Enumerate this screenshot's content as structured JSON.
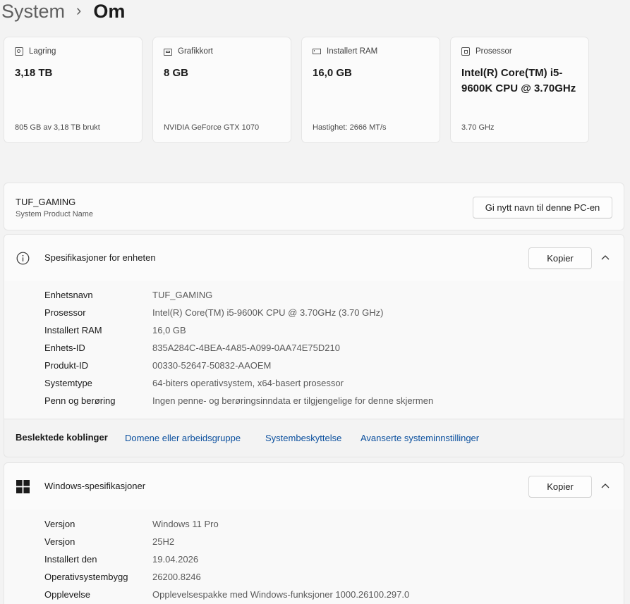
{
  "breadcrumb": {
    "parent": "System",
    "separator": "›",
    "current": "Om"
  },
  "cards": [
    {
      "label": "Lagring",
      "icon": "storage-icon",
      "value": "3,18 TB",
      "sub": "805 GB av 3,18 TB brukt"
    },
    {
      "label": "Grafikkort",
      "icon": "gpu-icon",
      "value": "8 GB",
      "sub": "NVIDIA GeForce GTX 1070"
    },
    {
      "label": "Installert RAM",
      "icon": "ram-icon",
      "value": "16,0 GB",
      "sub": "Hastighet: 2666 MT/s"
    },
    {
      "label": "Prosessor",
      "icon": "cpu-icon",
      "value": "Intel(R) Core(TM) i5-9600K CPU @ 3.70GHz",
      "sub": "3.70 GHz"
    }
  ],
  "pc_name": {
    "name": "TUF_GAMING",
    "subtitle": "System Product Name",
    "rename_label": "Gi nytt navn til denne PC-en"
  },
  "device_specs": {
    "title": "Spesifikasjoner for enheten",
    "copy_label": "Kopier",
    "rows": [
      {
        "key": "Enhetsnavn",
        "value": "TUF_GAMING"
      },
      {
        "key": "Prosessor",
        "value": "Intel(R) Core(TM) i5-9600K CPU @ 3.70GHz (3.70 GHz)"
      },
      {
        "key": "Installert RAM",
        "value": "16,0 GB"
      },
      {
        "key": "Enhets-ID",
        "value": "835A284C-4BEA-4A85-A099-0AA74E75D210"
      },
      {
        "key": "Produkt-ID",
        "value": "00330-52647-50832-AAOEM"
      },
      {
        "key": "Systemtype",
        "value": "64-biters operativsystem, x64-basert prosessor"
      },
      {
        "key": "Penn og berøring",
        "value": "Ingen penne- og berøringsinndata er tilgjengelige for denne skjermen"
      }
    ]
  },
  "related": {
    "label": "Beslektede koblinger",
    "links": [
      "Domene eller arbeidsgruppe",
      "Systembeskyttelse",
      "Avanserte systeminnstillinger"
    ]
  },
  "windows_specs": {
    "title": "Windows-spesifikasjoner",
    "copy_label": "Kopier",
    "rows": [
      {
        "key": "Versjon",
        "value": "Windows 11 Pro"
      },
      {
        "key": "Versjon",
        "value": "25H2"
      },
      {
        "key": "Installert den",
        "value": "19.04.2026"
      },
      {
        "key": "Operativsystembygg",
        "value": "26200.8246"
      },
      {
        "key": "Opplevelse",
        "value": "Opplevelsespakke med Windows-funksjoner 1000.26100.297.0"
      }
    ]
  },
  "colors": {
    "background": "#f3f3f3",
    "card": "#fbfbfb",
    "link": "#0a4f9e",
    "windows_logo": "#1b1b1b"
  }
}
